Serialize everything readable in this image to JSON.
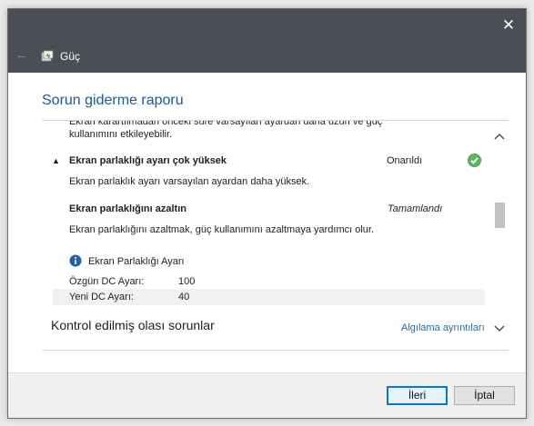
{
  "window": {
    "close_label": "✕",
    "back_label": "←",
    "title": "Güç"
  },
  "page": {
    "title": "Sorun giderme raporu"
  },
  "report": {
    "cut_line_1": "Ekran karartılmadan önceki süre varsayılan ayardan daha uzun ve güç",
    "cut_line_2": "kullanımını etkileyebilir.",
    "issue": {
      "toggle": "▲",
      "title": "Ekran parlaklığı ayarı çok yüksek",
      "status": "Onarıldı",
      "description": "Ekran parlaklık ayarı varsayılan ayardan daha yüksek."
    },
    "action": {
      "title": "Ekran parlaklığını azaltın",
      "status": "Tamamlandı",
      "description": "Ekran parlaklığını azaltmak, güç kullanımını azaltmaya yardımcı olur."
    },
    "setting": {
      "name": "Ekran Parlaklığı Ayarı",
      "rows": [
        {
          "label": "Özgün DC Ayarı:",
          "value": "100"
        },
        {
          "label": "Yeni DC Ayarı:",
          "value": "40"
        }
      ]
    },
    "section": {
      "title": "Kontrol edilmiş olası sorunlar",
      "link": "Algılama ayrıntıları"
    }
  },
  "buttons": {
    "next": "İleri",
    "cancel": "İptal"
  },
  "colors": {
    "titlebar": "#4a4e55",
    "accent": "#1a5aa0",
    "link": "#1a6fb5",
    "success": "#5cb85c"
  }
}
